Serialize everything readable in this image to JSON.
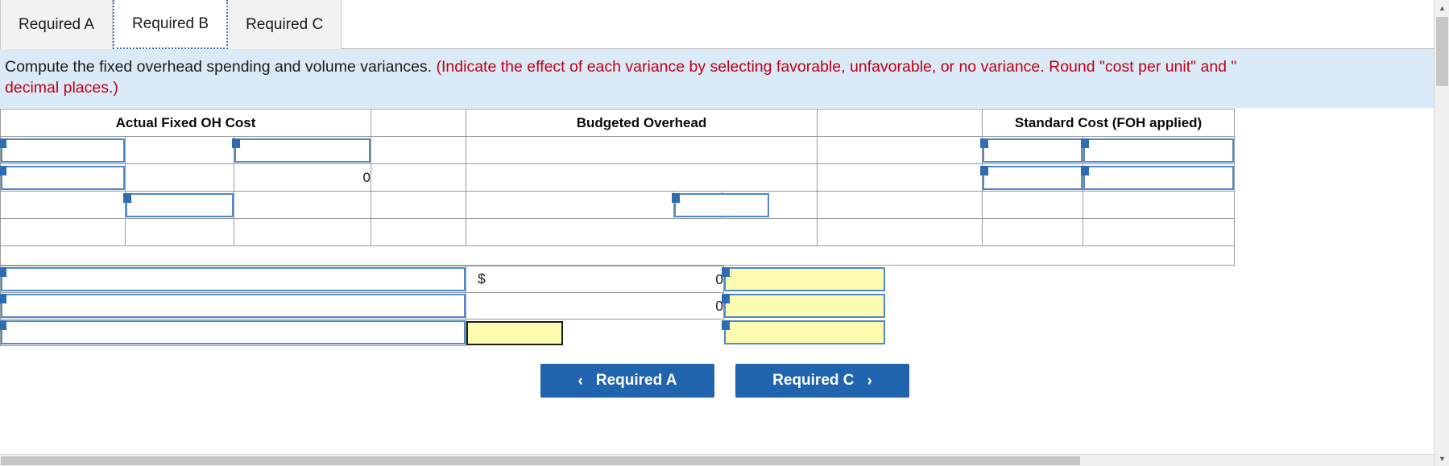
{
  "tabs": [
    {
      "label": "Required A",
      "active": false
    },
    {
      "label": "Required B",
      "active": true
    },
    {
      "label": "Required C",
      "active": false
    }
  ],
  "instructions": {
    "line1_prompt": "Compute the fixed overhead spending and volume variances.",
    "line1_hint": "(Indicate the effect of each variance by selecting favorable, unfavorable, or no variance. Round \"cost per unit\" and \"",
    "line2_hint": "decimal places.)"
  },
  "table": {
    "headers": {
      "actual": "Actual Fixed OH Cost",
      "budgeted": "Budgeted Overhead",
      "standard": "Standard Cost (FOH applied)"
    },
    "actual_col": {
      "row1_label_value": "",
      "row1_mid_value": "",
      "row1_right_value": "",
      "row2_label_value": "",
      "row2_mid_value": "",
      "row2_right_value": "0",
      "row3_mid_value": ""
    },
    "budgeted_col": {
      "row3_input_value": ""
    },
    "standard_col": {
      "row1_left_value": "",
      "row1_mid_value": "",
      "row1_right_value": "",
      "row2_left_value": "",
      "row2_mid_value": "",
      "row2_right_value": ""
    }
  },
  "variances": {
    "rows": [
      {
        "label_value": "",
        "dollar_symbol": "$",
        "amount": "0",
        "effect_value": ""
      },
      {
        "label_value": "",
        "dollar_symbol": "",
        "amount": "0",
        "effect_value": ""
      },
      {
        "label_value": "",
        "dollar_symbol": "",
        "amount": "",
        "effect_value": ""
      }
    ]
  },
  "nav": {
    "prev_label": "Required A",
    "prev_icon": "chevron-left-icon",
    "prev_glyph": "‹",
    "next_label": "Required C",
    "next_icon": "chevron-right-icon",
    "next_glyph": "›"
  },
  "scroll": {
    "up_glyph": "▲",
    "down_glyph": "▼"
  },
  "colors": {
    "header_blue": "#77a9e0",
    "banner_blue": "#dbeaf7",
    "hint_red": "#c00016",
    "input_border": "#5089c6",
    "highlight_yellow": "#fdfbaf",
    "button_blue": "#1f64ad"
  }
}
